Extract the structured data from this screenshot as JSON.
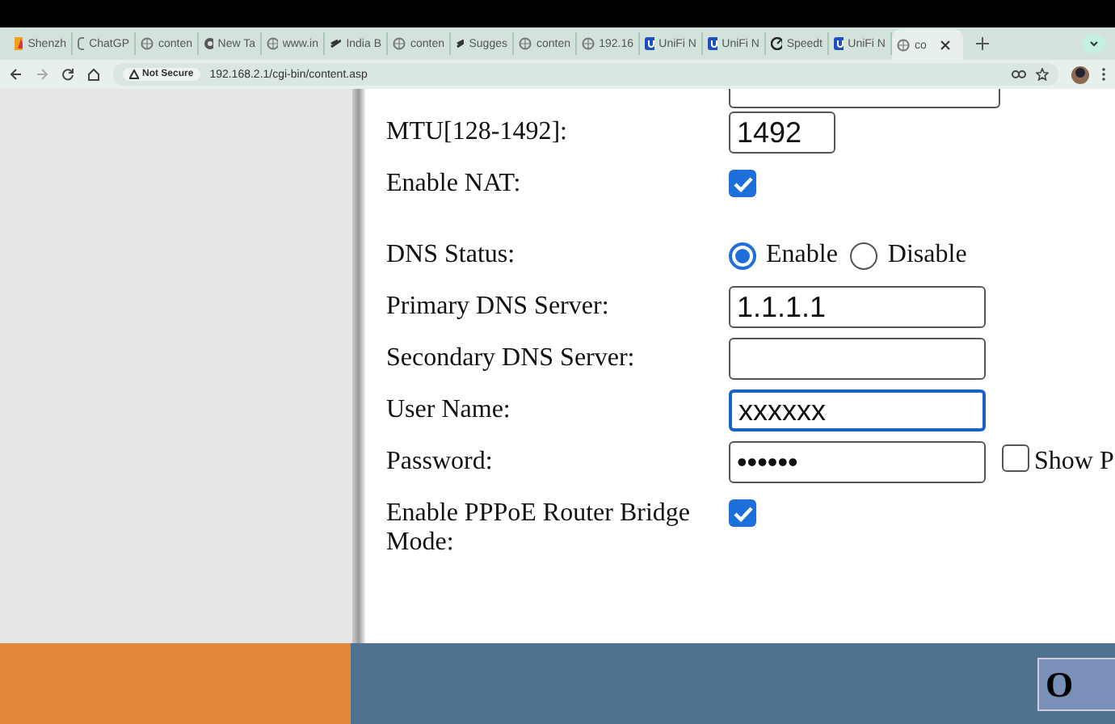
{
  "browser": {
    "tabs": [
      {
        "label": "Shenzh",
        "kind": "flame",
        "selected": false
      },
      {
        "label": "ChatGP",
        "kind": "chat",
        "selected": false
      },
      {
        "label": "conten",
        "kind": "globe",
        "selected": false
      },
      {
        "label": "New Ta",
        "kind": "chrome",
        "selected": false
      },
      {
        "label": "www.in",
        "kind": "globe",
        "selected": false
      },
      {
        "label": "India B",
        "kind": "bars",
        "selected": false
      },
      {
        "label": "conten",
        "kind": "globe",
        "selected": false
      },
      {
        "label": "Sugges",
        "kind": "bars",
        "selected": false
      },
      {
        "label": "conten",
        "kind": "globe",
        "selected": false
      },
      {
        "label": "192.16",
        "kind": "globe",
        "selected": false
      },
      {
        "label": "UniFi N",
        "kind": "u",
        "selected": false
      },
      {
        "label": "UniFi N",
        "kind": "u",
        "selected": false
      },
      {
        "label": "Speedt",
        "kind": "speed",
        "selected": false
      },
      {
        "label": "UniFi N",
        "kind": "u",
        "selected": false
      },
      {
        "label": "co",
        "kind": "globe",
        "selected": true
      }
    ],
    "security": "Not Secure",
    "url": "192.168.2.1/cgi-bin/content.asp"
  },
  "form": {
    "rows": [
      {
        "kind": "stub"
      },
      {
        "kind": "number",
        "label": "MTU[128-1492]:",
        "value": "1492",
        "focused": false
      },
      {
        "kind": "checkbox",
        "label": "Enable NAT:",
        "checked": true
      },
      {
        "kind": "gap"
      },
      {
        "kind": "radio",
        "label": "DNS Status:",
        "options": [
          {
            "label": "Enable",
            "selected": true
          },
          {
            "label": "Disable",
            "selected": false
          }
        ]
      },
      {
        "kind": "text",
        "label": "Primary DNS Server:",
        "value": "1.1.1.1",
        "focused": false
      },
      {
        "kind": "text",
        "label": "Secondary DNS Server:",
        "value": "",
        "focused": false
      },
      {
        "kind": "text",
        "label": "User Name:",
        "value": "xxxxxx",
        "focused": true
      },
      {
        "kind": "password",
        "label": "Password:",
        "value": "••••••",
        "focused": false,
        "show_label": "Show P",
        "show_checked": false
      },
      {
        "kind": "checkbox",
        "label": "Enable PPPoE Router Bridge Mode:",
        "checked": true
      }
    ]
  },
  "footer": {
    "button": "O"
  }
}
